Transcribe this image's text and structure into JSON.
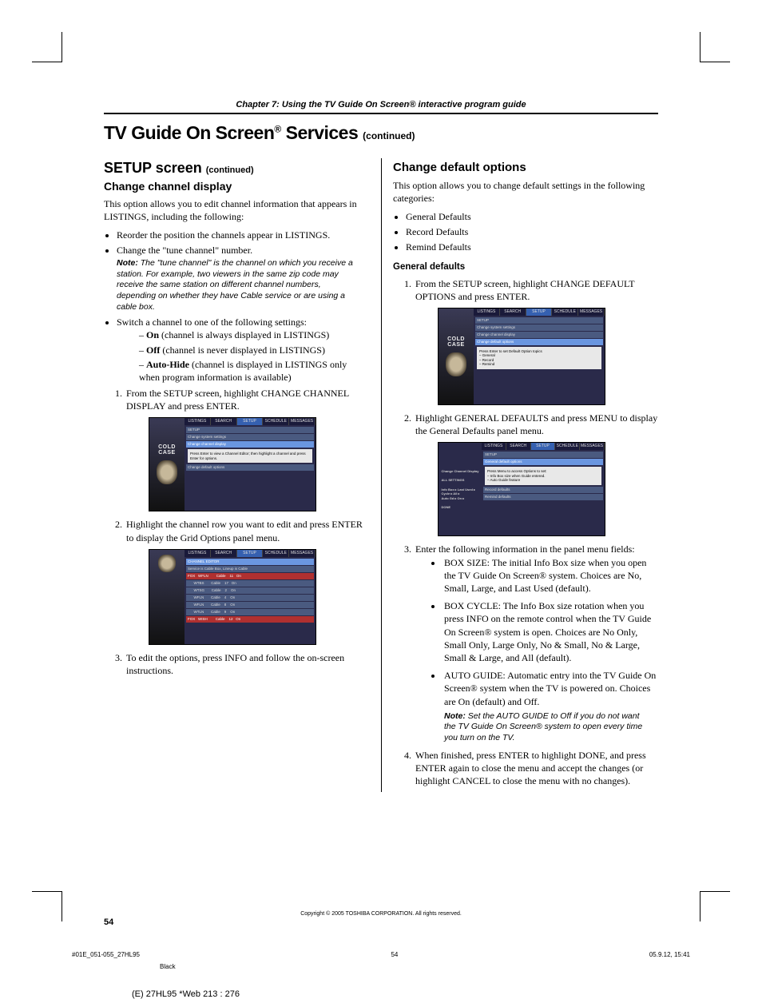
{
  "chapter": "Chapter 7: Using the TV Guide On Screen® interactive program guide",
  "title_a": "TV Guide On Screen",
  "title_b": " Services ",
  "title_cont": "(continued)",
  "reg": "®",
  "left": {
    "setup_h": "SETUP screen ",
    "setup_cont": "(continued)",
    "ccd_h": "Change channel display",
    "ccd_intro": "This option allows you to edit channel information that appears in LISTINGS, including the following:",
    "ccd_b1": "Reorder the position the channels appear in LISTINGS.",
    "ccd_b2": "Change the \"tune channel\" number.",
    "ccd_note": "The \"tune channel\" is the channel on which you receive a station. For example, two viewers in the same zip code may receive the same station on different channel numbers, depending on whether they have Cable service or are using a cable box.",
    "ccd_b3": "Switch a channel to one of the following settings:",
    "sw_on_b": "On",
    "sw_on_t": " (channel is always displayed in LISTINGS)",
    "sw_off_b": "Off",
    "sw_off_t": " (channel is never displayed in LISTINGS)",
    "sw_ah_b": "Auto-Hide",
    "sw_ah_t": " (channel is displayed in LISTINGS only when program information is available)",
    "step1": "From the SETUP screen, highlight CHANGE CHANNEL DISPLAY and press ENTER.",
    "step2": "Highlight the channel row you want to edit and press ENTER to display the Grid Options panel menu.",
    "step3": "To edit the options, press INFO and follow the on-screen instructions."
  },
  "right": {
    "cdo_h": "Change default options",
    "cdo_intro": "This option allows you to change default settings in the following categories:",
    "cdo_b1": "General Defaults",
    "cdo_b2": "Record Defaults",
    "cdo_b3": "Remind Defaults",
    "gd_h": "General defaults",
    "gd_s1": "From the SETUP screen, highlight CHANGE DEFAULT OPTIONS and press ENTER.",
    "gd_s2": "Highlight GENERAL DEFAULTS and press MENU to display the General Defaults panel menu.",
    "gd_s3": "Enter the following information in the panel menu fields:",
    "box_size": "BOX SIZE: The initial Info Box size when you open the TV Guide On Screen® system. Choices are No, Small, Large, and Last Used (default).",
    "box_cycle": "BOX CYCLE: The Info Box size rotation when you press INFO on the remote control when the TV Guide On Screen® system is open. Choices are No Only, Small Only, Large Only, No & Small, No & Large, Small & Large, and All (default).",
    "auto_guide": "AUTO GUIDE: Automatic entry into the TV Guide On Screen® system when the TV is powered on. Choices are On (default) and Off.",
    "ag_note": "Set the AUTO GUIDE to Off if you do not want the TV Guide On Screen® system to open every time you turn on the TV.",
    "gd_s4": "When finished, press ENTER to highlight DONE, and press ENTER again to close the menu and accept the changes (or highlight CANCEL to close the menu with no changes)."
  },
  "note_label": "Note: ",
  "ss": {
    "tabs": [
      "LISTINGS",
      "SEARCH",
      "SETUP",
      "SCHEDULE",
      "MESSAGES"
    ],
    "cold": "COLD",
    "case": "CASE",
    "s1_rows": [
      "SETUP",
      "Change system settings",
      "Change channel display"
    ],
    "s1_box": "Press Enter to view a Channel Editor; then highlight a channel and press Enter for options.",
    "s1_row_last": "Change default options",
    "s2_header": "CHANNEL EDITOR",
    "s2_sub": "Service is Cable Box, Lineup is Cable",
    "s3_rows": [
      "SETUP",
      "Change system settings",
      "Change channel display",
      "Change default options"
    ],
    "s3_box": "Press Enter to set Default Option topics\n – General\n – Record\n – Remind",
    "s4_rows": [
      "SETUP",
      "General default options"
    ],
    "s4_box": "Press Menu to access Options to set:\n – Info Box size when Guide entered.\n – Auto Guide feature"
  },
  "footer": {
    "copyright": "Copyright © 2005 TOSHIBA CORPORATION. All rights reserved.",
    "page": "54",
    "line_l": "#01E_051-055_27HL95",
    "line_c": "54",
    "line_r": "05.9.12, 15:41",
    "black": "Black",
    "web": "(E) 27HL95 *Web 213 : 276"
  }
}
